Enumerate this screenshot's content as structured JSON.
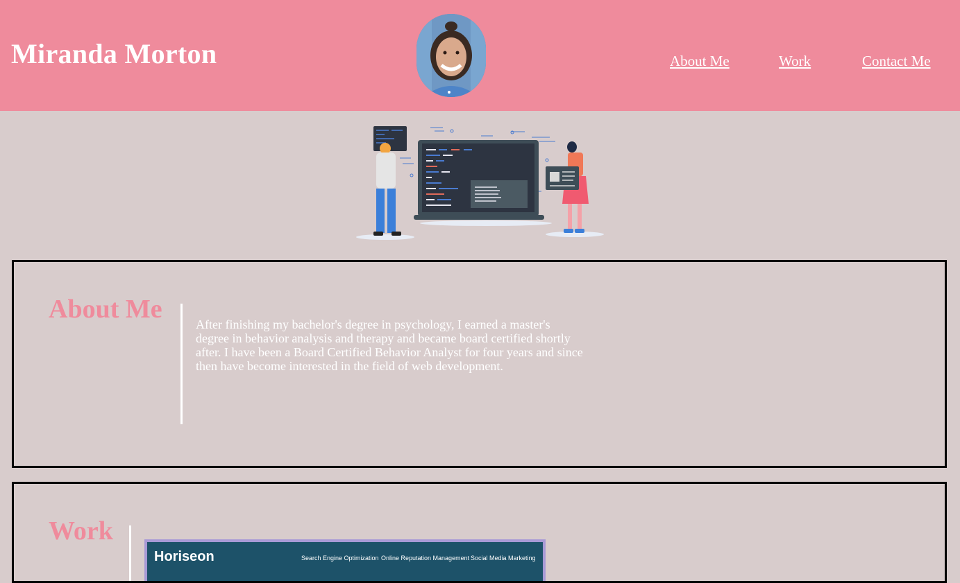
{
  "header": {
    "site_title": "Miranda Morton",
    "nav": [
      "About Me",
      "Work",
      "Contact Me"
    ]
  },
  "about": {
    "title": "About Me",
    "text": "After finishing my bachelor's degree in psychology, I earned a master's degree in behavior analysis and therapy and became board certified shortly after. I have been a Board Certified Behavior Analyst for four years and since then have become interested in the field of web development."
  },
  "work": {
    "title": "Work",
    "project": {
      "brand": "Horiseon",
      "links": [
        "Search Engine Optimization",
        "Online Reputation Management",
        "Social Media Marketing"
      ]
    }
  },
  "colors": {
    "accent": "#ef8b9c",
    "background": "#d8cccc",
    "text_light": "#ffffff",
    "border": "#000000"
  }
}
